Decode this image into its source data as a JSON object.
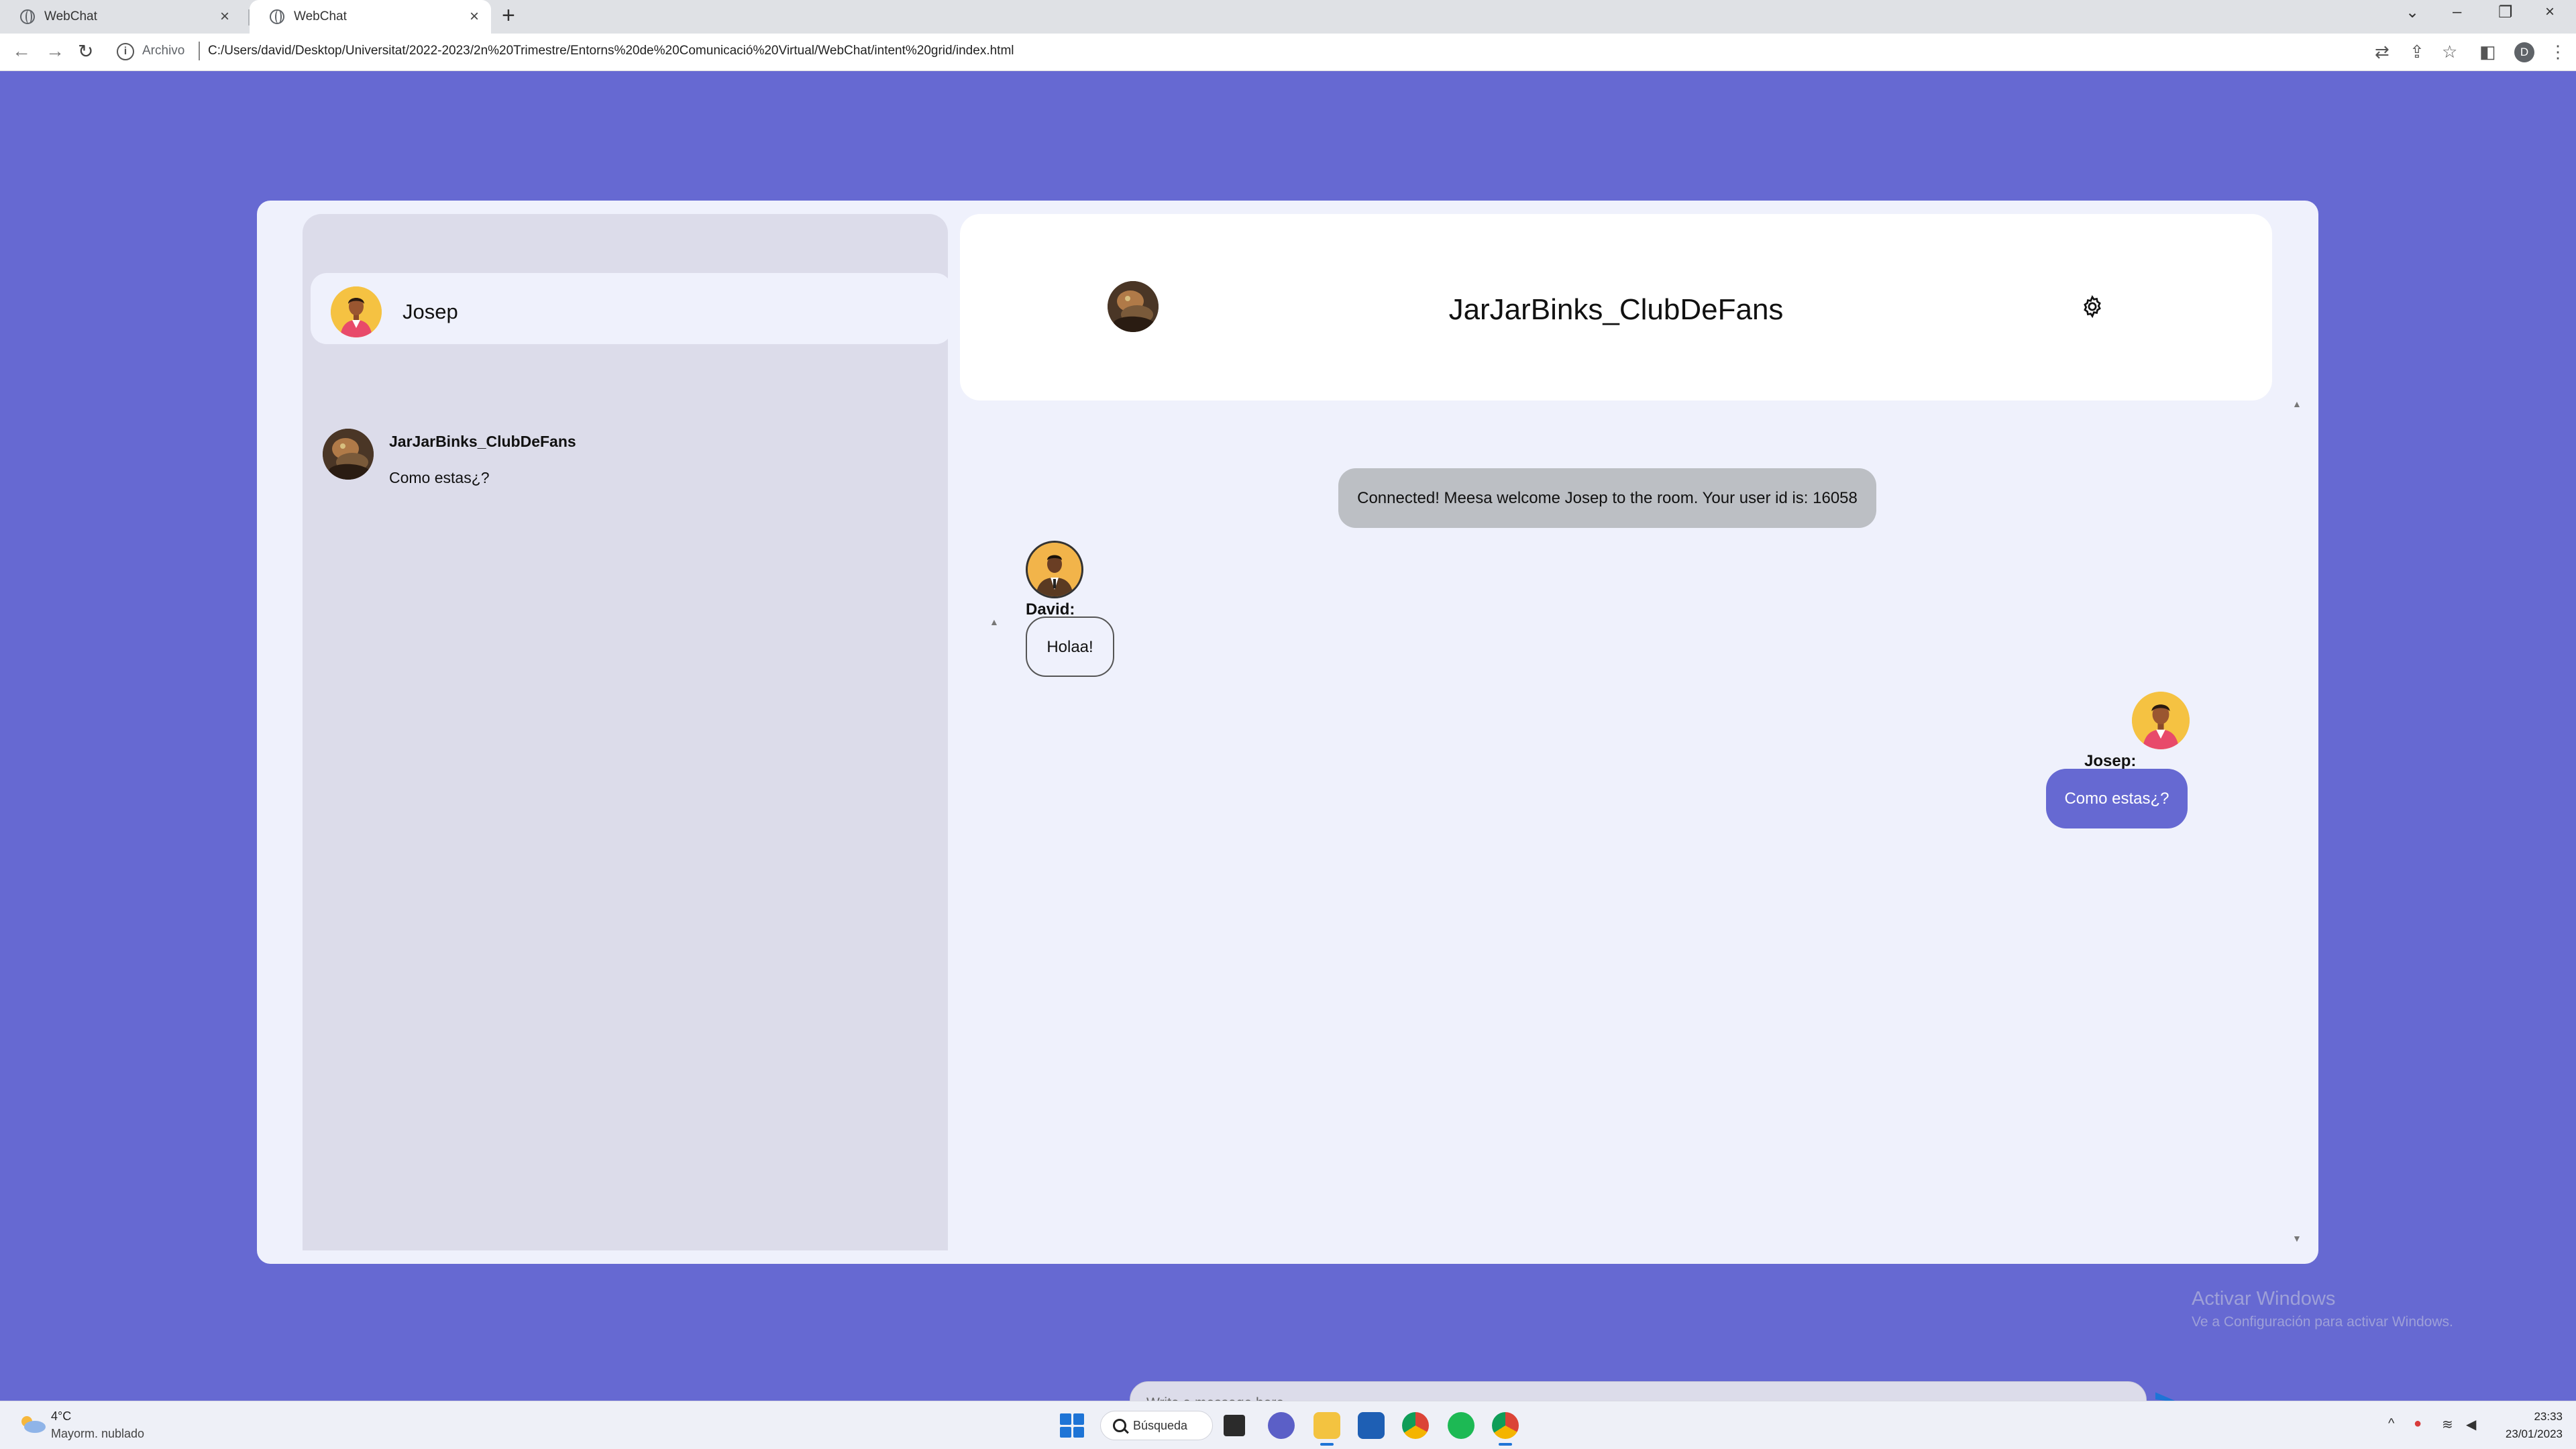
{
  "browser": {
    "tabs": [
      {
        "title": "WebChat",
        "active": false
      },
      {
        "title": "WebChat",
        "active": true
      }
    ],
    "scheme_label": "Archivo",
    "url": "C:/Users/david/Desktop/Universitat/2022-2023/2n%20Trimestre/Entorns%20de%20Comunicació%20Virtual/WebChat/intent%20grid/index.html",
    "profile_initial": "D"
  },
  "sidebar": {
    "current_user": "Josep",
    "conversations": [
      {
        "name": "JarJarBinks_ClubDeFans",
        "last_message": "Como estas¿?"
      }
    ]
  },
  "chat": {
    "room_name": "JarJarBinks_ClubDeFans",
    "system_message": "Connected! Meesa welcome Josep to the room. Your user id is: 16058",
    "messages": [
      {
        "sender": "David:",
        "text": "Holaa!",
        "direction": "incoming"
      },
      {
        "sender": "Josep:",
        "text": "Como estas¿?",
        "direction": "outgoing"
      }
    ],
    "input_placeholder": "Write a message here"
  },
  "watermark": {
    "title": "Activar Windows",
    "subtitle": "Ve a Configuración para activar Windows."
  },
  "taskbar": {
    "weather_temp": "4°C",
    "weather_desc": "Mayorm. nublado",
    "search_label": "Búsqueda",
    "time": "23:33",
    "date": "23/01/2023"
  },
  "colors": {
    "background": "#6669d2",
    "outgoing_bubble": "#6669d2",
    "sidebar": "#dcdcea",
    "chat_bg": "#eff1fc",
    "system_bubble": "#bcbfc4",
    "send_icon": "#1e74d6"
  }
}
